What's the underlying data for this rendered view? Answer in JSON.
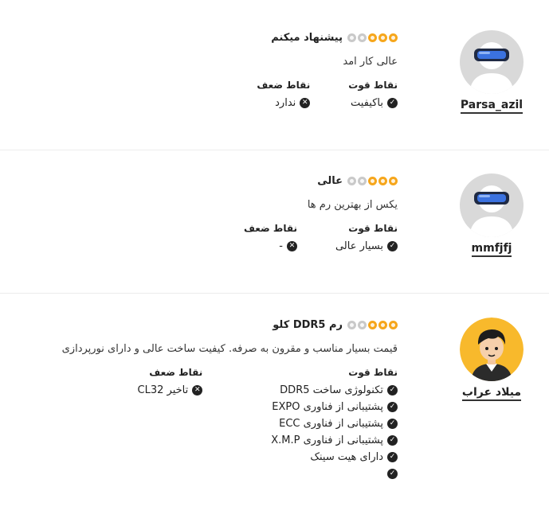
{
  "labels": {
    "pros": "نقاط قوت",
    "cons": "نقاط ضعف"
  },
  "colors": {
    "star_on": "#f6a61b",
    "star_off": "#c9c9c9",
    "avatar_bg_gray": "#d9d9d9",
    "avatar_bg_yellow": "#f8b92c"
  },
  "reviews": [
    {
      "user": "Parsa_azil",
      "avatar_icon": "vr-headset-avatar-icon",
      "rating": 3,
      "rating_max": 5,
      "title": "پیشنهاد میکنم",
      "comment": "عالی کار امد",
      "pros": [
        "باکیفیت"
      ],
      "cons": [
        "ندارد"
      ]
    },
    {
      "user": "mmfjfj",
      "avatar_icon": "vr-headset-avatar-icon",
      "rating": 3,
      "rating_max": 5,
      "title": "عالی",
      "comment": "یکس از بهترین رم ها",
      "pros": [
        "بسیار عالی"
      ],
      "cons": [
        "-"
      ]
    },
    {
      "user": "میلاد عراب",
      "avatar_icon": "cartoon-boy-avatar-icon",
      "rating": 3,
      "rating_max": 5,
      "title": "رم DDR5 کلو",
      "comment": "قیمت بسیار مناسب و مقرون به صرفه. کیفیت ساخت عالی و دارای نورپردازی",
      "pros": [
        "تکنولوژی ساخت DDR5",
        "پشتیبانی از فناوری EXPO",
        "پشتیبانی از فناوری ECC",
        "پشتیبانی از فناوری X.M.P",
        "دارای هیت سینک",
        ""
      ],
      "cons": [
        "تاخیر CL32"
      ]
    }
  ]
}
